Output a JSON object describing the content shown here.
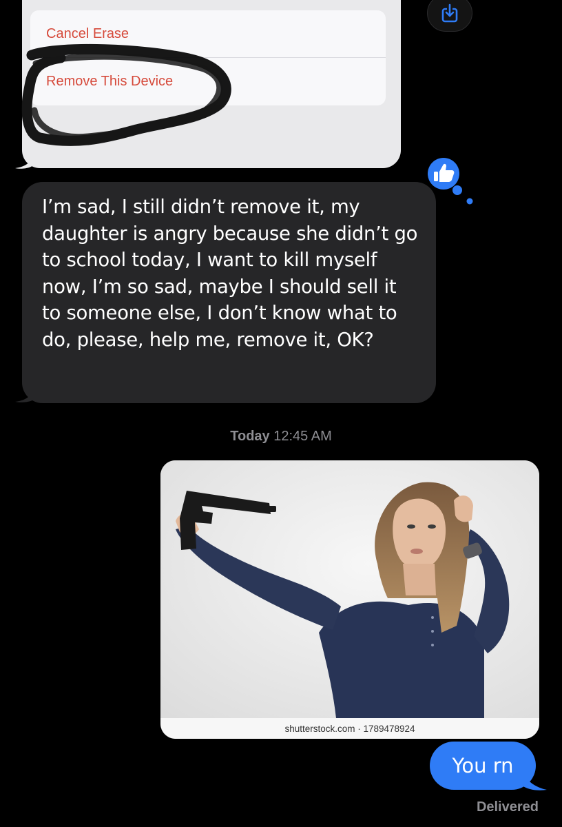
{
  "attachment": {
    "actions": [
      "Cancel Erase",
      "Remove This Device"
    ],
    "accent_color": "#d64a3b"
  },
  "save_button": {
    "icon": "download-icon"
  },
  "tapback": {
    "icon": "thumbs-up-icon",
    "color": "#2f7cf6"
  },
  "received_message": {
    "text": "I’m sad, I still didn’t remove it, my daughter is angry because she didn’t go to school today, I want to kill myself now, I’m so sad, maybe I should sell it to someone else, I don’t know what to do, please, help me, remove it, OK?"
  },
  "timestamp": {
    "day": "Today",
    "time": "12:45 AM"
  },
  "sent_image": {
    "watermark": "shutterstock.com · 1789478924"
  },
  "sent_message": {
    "text": "You rn"
  },
  "status": "Delivered",
  "colors": {
    "sent_bubble": "#2f7cf6",
    "received_bubble": "#262628",
    "background": "#000000"
  }
}
